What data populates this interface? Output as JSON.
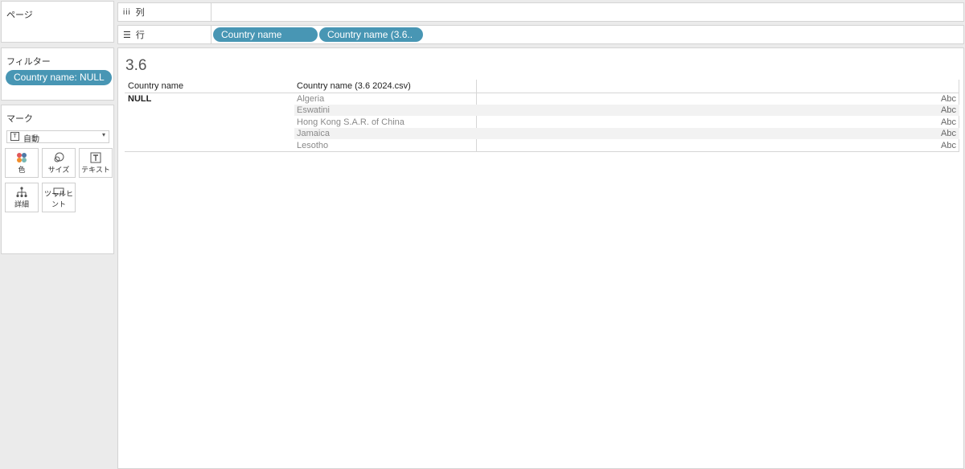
{
  "pages_panel": {
    "title": "ページ"
  },
  "filters_panel": {
    "title": "フィルター",
    "filter_pill": "Country name: NULL"
  },
  "marks_panel": {
    "title": "マーク",
    "mark_type": "自動",
    "buttons": [
      {
        "label": "色",
        "icon": "color-dots-icon"
      },
      {
        "label": "サイズ",
        "icon": "size-circles-icon"
      },
      {
        "label": "テキスト",
        "icon": "text-T-icon"
      },
      {
        "label": "詳細",
        "icon": "detail-tree-icon"
      },
      {
        "label": "ツールヒント",
        "icon": "tooltip-bubble-icon"
      }
    ]
  },
  "columns_shelf": {
    "label": "列",
    "icon": "columns-icon"
  },
  "rows_shelf": {
    "label": "行",
    "icon": "rows-icon",
    "pills": [
      "Country name",
      "Country name (3.6.."
    ]
  },
  "view": {
    "title": "3.6",
    "headers": [
      "Country name",
      "Country name (3.6 2024.csv)"
    ],
    "group_value": "NULL",
    "rows": [
      {
        "name": "Algeria",
        "value": "Abc"
      },
      {
        "name": "Eswatini",
        "value": "Abc"
      },
      {
        "name": "Hong Kong S.A.R. of China",
        "value": "Abc"
      },
      {
        "name": "Jamaica",
        "value": "Abc"
      },
      {
        "name": "Lesotho",
        "value": "Abc"
      }
    ]
  },
  "colors": {
    "pill": "#4896b4",
    "band": "#f2f2f2"
  }
}
